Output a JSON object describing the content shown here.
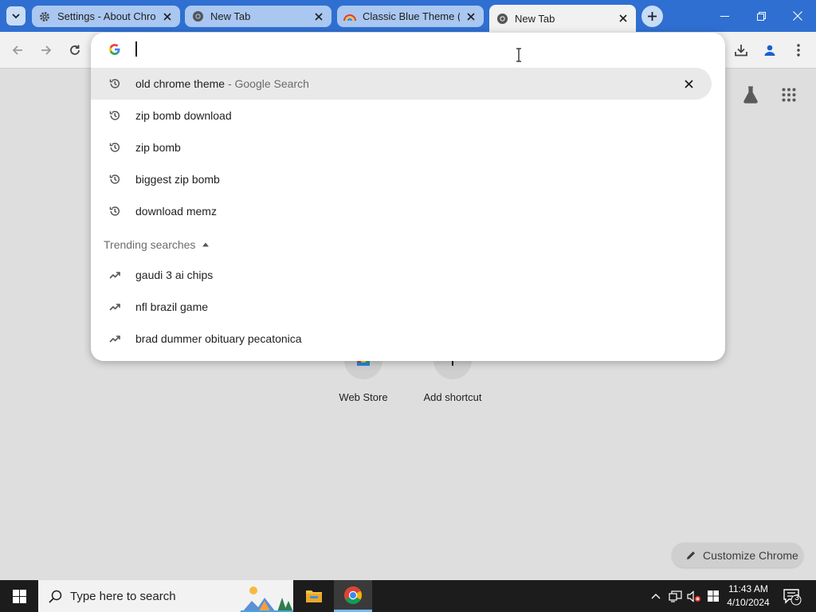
{
  "tabs": [
    {
      "title": "Settings - About Chrome",
      "favicon": "gear-icon",
      "active": false
    },
    {
      "title": "New Tab",
      "favicon": "chrome-icon",
      "active": false
    },
    {
      "title": "Classic Blue Theme (by...",
      "favicon": "theme-rainbow-icon",
      "active": false
    },
    {
      "title": "New Tab",
      "favicon": "chrome-icon",
      "active": true
    }
  ],
  "omnibox": {
    "value": "",
    "suggestions": [
      {
        "text": "old chrome theme",
        "sub": " - Google Search",
        "icon": "history-icon",
        "selected": true
      },
      {
        "text": "zip bomb download",
        "sub": "",
        "icon": "history-icon",
        "selected": false
      },
      {
        "text": "zip bomb",
        "sub": "",
        "icon": "history-icon",
        "selected": false
      },
      {
        "text": "biggest zip bomb",
        "sub": "",
        "icon": "history-icon",
        "selected": false
      },
      {
        "text": "download memz",
        "sub": "",
        "icon": "history-icon",
        "selected": false
      }
    ],
    "trending_header": "Trending searches",
    "trending": [
      {
        "text": "gaudi 3 ai chips",
        "icon": "trending-icon"
      },
      {
        "text": "nfl brazil game",
        "icon": "trending-icon"
      },
      {
        "text": "brad dummer obituary pecatonica",
        "icon": "trending-icon"
      }
    ]
  },
  "ntp": {
    "shortcuts": [
      {
        "label": "Web Store"
      },
      {
        "label": "Add shortcut"
      }
    ],
    "customize_label": "Customize Chrome"
  },
  "taskbar": {
    "search_placeholder": "Type here to search",
    "time": "11:43 AM",
    "date": "4/10/2024",
    "notifications": "3"
  },
  "colors": {
    "titlebar": "#2f6fd1",
    "toolbar": "#f1f1f1",
    "page_bg": "#dedede",
    "taskbar": "#1c1c1c"
  }
}
